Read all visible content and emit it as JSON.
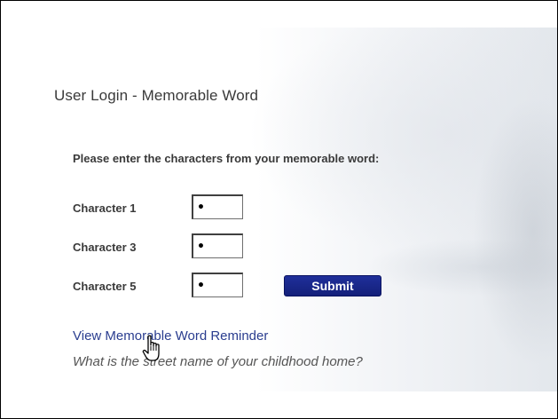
{
  "login": {
    "title": "User Login - Memorable Word",
    "instructions": "Please enter the characters from your memorable word:",
    "fields": [
      {
        "label": "Character 1",
        "value": "•"
      },
      {
        "label": "Character 3",
        "value": "•"
      },
      {
        "label": "Character 5",
        "value": "•"
      }
    ],
    "submit_label": "Submit",
    "reminder_link": "View Memorable Word Reminder",
    "reminder_hint": "What is the street name of your childhood home?"
  },
  "colors": {
    "submit_bg": "#1a2a8a",
    "link": "#2a3d8f",
    "text": "#3a3a3a"
  },
  "icons": {
    "cursor": "hand-pointer-cursor-icon"
  }
}
